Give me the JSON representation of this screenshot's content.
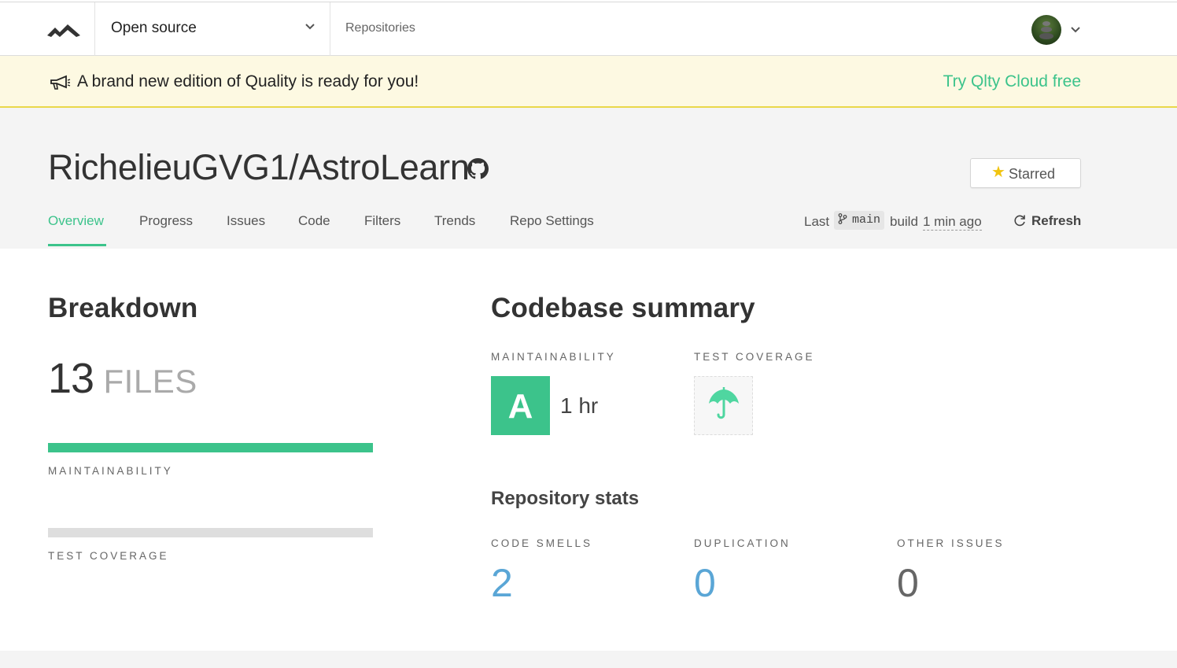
{
  "nav": {
    "org_selector": "Open source",
    "repositories_link": "Repositories"
  },
  "banner": {
    "message": "A brand new edition of Quality is ready for you!",
    "cta": "Try Qlty Cloud free"
  },
  "repo": {
    "title": "RichelieuGVG1/AstroLearn",
    "star_button": "Starred",
    "tabs": [
      "Overview",
      "Progress",
      "Issues",
      "Code",
      "Filters",
      "Trends",
      "Repo Settings"
    ],
    "active_tab": "Overview",
    "build": {
      "prefix": "Last",
      "branch": "main",
      "middle": "build",
      "time_ago": "1 min ago"
    },
    "refresh": "Refresh"
  },
  "breakdown": {
    "title": "Breakdown",
    "file_count": "13",
    "file_unit": "FILES",
    "maintainability_label": "MAINTAINABILITY",
    "maintainability_fill": 1.0,
    "test_coverage_label": "TEST COVERAGE",
    "test_coverage_fill": 0
  },
  "summary": {
    "title": "Codebase summary",
    "maintainability_label": "MAINTAINABILITY",
    "grade": "A",
    "tech_debt": "1 hr",
    "test_coverage_label": "TEST COVERAGE"
  },
  "stats": {
    "title": "Repository stats",
    "items": [
      {
        "label": "CODE SMELLS",
        "value": "2"
      },
      {
        "label": "DUPLICATION",
        "value": "0"
      },
      {
        "label": "OTHER ISSUES",
        "value": "0"
      }
    ]
  },
  "colors": {
    "accent": "#3cc38b",
    "link_blue": "#5aa6d6",
    "banner_bg": "#fdf9e2",
    "banner_border": "#e9d84a"
  }
}
